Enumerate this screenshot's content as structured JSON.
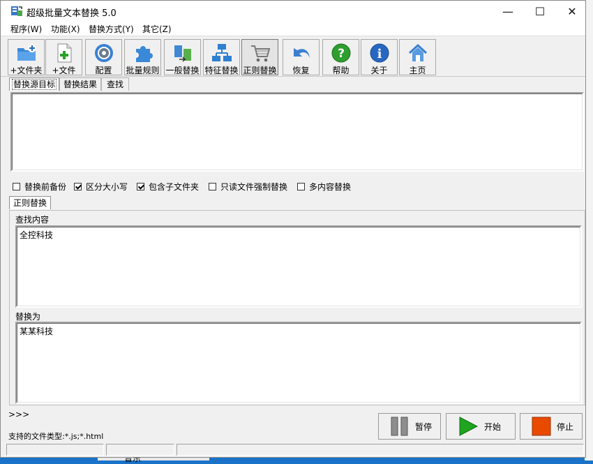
{
  "window": {
    "title": "超级批量文本替换 5.0"
  },
  "window_controls": {
    "minimize": "—",
    "maximize": "☐",
    "close": "✕"
  },
  "menu": [
    "程序(W)",
    "功能(X)",
    "替换方式(Y)",
    "其它(Z)"
  ],
  "toolbar": [
    {
      "label": "+文件夹",
      "icon": "folder-add-icon"
    },
    {
      "label": "+文件",
      "icon": "file-add-icon"
    },
    {
      "label": "配置",
      "icon": "settings-gear-icon"
    },
    {
      "label": "批量规则",
      "icon": "puzzle-icon"
    },
    {
      "label": "一般替换",
      "icon": "swap-icon"
    },
    {
      "label": "特征替换",
      "icon": "network-icon"
    },
    {
      "label": "正则替换",
      "icon": "cart-icon"
    },
    {
      "label": "恢复",
      "icon": "undo-arrow-icon"
    },
    {
      "label": "帮助",
      "icon": "help-icon"
    },
    {
      "label": "关于",
      "icon": "info-icon"
    },
    {
      "label": "主页",
      "icon": "home-icon"
    }
  ],
  "top_tabs": [
    "替换源目标",
    "替换结果",
    "查找"
  ],
  "options": [
    {
      "label": "替换前备份",
      "checked": false
    },
    {
      "label": "区分大小写",
      "checked": true
    },
    {
      "label": "包含子文件夹",
      "checked": true
    },
    {
      "label": "只读文件强制替换",
      "checked": false
    },
    {
      "label": "多内容替换",
      "checked": false
    }
  ],
  "mode_tab": "正则替换",
  "find": {
    "label": "查找内容",
    "value": "全控科技"
  },
  "replace": {
    "label": "替换为",
    "value": "某某科技"
  },
  "bottom": {
    "prompt": ">>>",
    "file_types": "支持的文件类型:*.js;*.html"
  },
  "buttons": {
    "pause": "暂停",
    "start": "开始",
    "stop": "停止"
  },
  "background": {
    "fragment": "音乐"
  },
  "colors": {
    "accent_blue": "#1a73c9",
    "start_green": "#1fa51f",
    "stop_orange": "#e84a00",
    "help_green": "#2e9e2e",
    "info_blue": "#2767c2"
  }
}
